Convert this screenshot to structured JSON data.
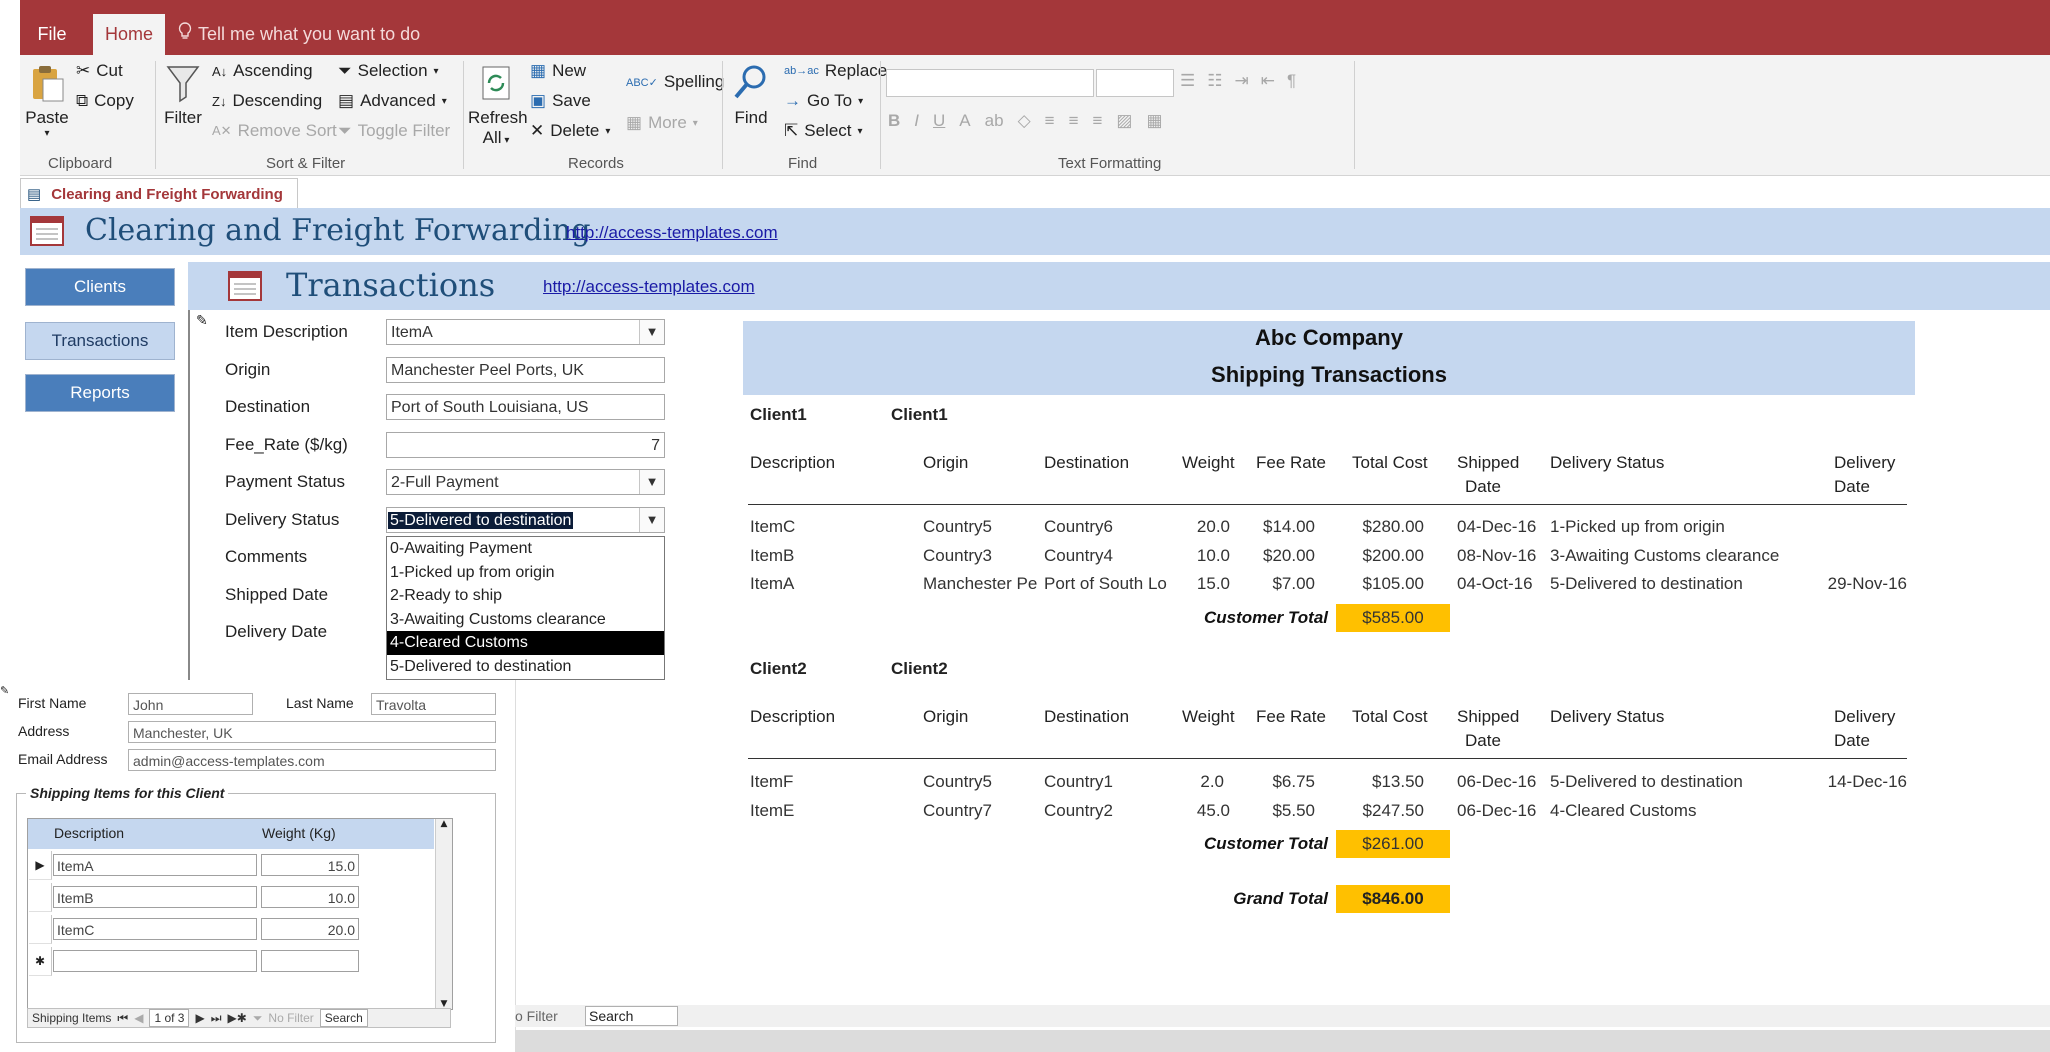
{
  "ribbon": {
    "tabs": {
      "file": "File",
      "home": "Home",
      "tell_me": "Tell me what you want to do"
    },
    "clipboard": {
      "paste": "Paste",
      "cut": "Cut",
      "copy": "Copy",
      "group": "Clipboard"
    },
    "sort_filter": {
      "filter": "Filter",
      "ascending": "Ascending",
      "descending": "Descending",
      "remove_sort": "Remove Sort",
      "selection": "Selection",
      "advanced": "Advanced",
      "toggle_filter": "Toggle Filter",
      "group": "Sort & Filter"
    },
    "records": {
      "refresh": "Refresh",
      "refresh_all": "All",
      "new": "New",
      "save": "Save",
      "delete": "Delete",
      "spelling": "Spelling",
      "more": "More",
      "group": "Records"
    },
    "find": {
      "find": "Find",
      "replace": "Replace",
      "goto": "Go To",
      "select": "Select",
      "group": "Find"
    },
    "text_formatting": {
      "group": "Text Formatting"
    }
  },
  "object_tab": "Clearing and Freight Forwarding",
  "main_header": {
    "title": "Clearing and Freight Forwarding",
    "link": "http://access-templates.com"
  },
  "nav": {
    "clients": "Clients",
    "transactions": "Transactions",
    "reports": "Reports"
  },
  "transactions_header": {
    "title": "Transactions",
    "link": "http://access-templates.com"
  },
  "form": {
    "labels": {
      "item_description": "Item Description",
      "origin": "Origin",
      "destination": "Destination",
      "fee_rate": "Fee_Rate ($/kg)",
      "payment_status": "Payment Status",
      "delivery_status": "Delivery Status",
      "comments": "Comments",
      "shipped_date": "Shipped Date",
      "delivery_date": "Delivery Date"
    },
    "values": {
      "item_description": "ItemA",
      "origin": "Manchester Peel Ports, UK",
      "destination": "Port of South Louisiana, US",
      "fee_rate": "7",
      "payment_status": "2-Full Payment",
      "delivery_status": "5-Delivered to destination"
    },
    "delivery_options": [
      "0-Awaiting Payment",
      "1-Picked up from origin",
      "2-Ready to ship",
      "3-Awaiting Customs clearance",
      "4-Cleared Customs",
      "5-Delivered to destination"
    ],
    "highlighted_option": "4-Cleared Customs"
  },
  "client": {
    "first_name_label": "First Name",
    "first_name": "John",
    "last_name_label": "Last Name",
    "last_name": "Travolta",
    "address_label": "Address",
    "address": "Manchester, UK",
    "email_label": "Email Address",
    "email": "admin@access-templates.com",
    "items_title": "Shipping Items for this Client",
    "grid_headers": {
      "description": "Description",
      "weight": "Weight (Kg)"
    },
    "grid_rows": [
      {
        "description": "ItemA",
        "weight": "15.0"
      },
      {
        "description": "ItemB",
        "weight": "10.0"
      },
      {
        "description": "ItemC",
        "weight": "20.0"
      }
    ],
    "navbar": {
      "label": "Shipping Items",
      "record": "1 of 3",
      "no_filter": "No Filter",
      "search": "Search"
    }
  },
  "outer_navbar": {
    "no_filter": "o Filter",
    "search": "Search"
  },
  "report": {
    "company": "Abc Company",
    "title": "Shipping Transactions",
    "columns": {
      "description": "Description",
      "origin": "Origin",
      "destination": "Destination",
      "weight": "Weight",
      "fee_rate": "Fee Rate",
      "total_cost": "Total Cost",
      "shipped": "Shipped",
      "shipped2": "Date",
      "delivery_status": "Delivery Status",
      "delivery": "Delivery",
      "delivery2": "Date"
    },
    "groups": [
      {
        "id_label": "Client1",
        "name": "Client1",
        "rows": [
          {
            "description": "ItemC",
            "origin": "Country5",
            "destination": "Country6",
            "weight": "20.0",
            "fee": "$14.00",
            "cost": "$280.00",
            "shipped": "04-Dec-16",
            "status": "1-Picked up from origin",
            "delivered": ""
          },
          {
            "description": "ItemB",
            "origin": "Country3",
            "destination": "Country4",
            "weight": "10.0",
            "fee": "$20.00",
            "cost": "$200.00",
            "shipped": "08-Nov-16",
            "status": "3-Awaiting Customs clearance",
            "delivered": ""
          },
          {
            "description": "ItemA",
            "origin": "Manchester Pe",
            "destination": "Port of South Lo",
            "weight": "15.0",
            "fee": "$7.00",
            "cost": "$105.00",
            "shipped": "04-Oct-16",
            "status": "5-Delivered to destination",
            "delivered": "29-Nov-16"
          }
        ],
        "total_label": "Customer Total",
        "total": "$585.00"
      },
      {
        "id_label": "Client2",
        "name": "Client2",
        "rows": [
          {
            "description": "ItemF",
            "origin": "Country5",
            "destination": "Country1",
            "weight": "2.0",
            "fee": "$6.75",
            "cost": "$13.50",
            "shipped": "06-Dec-16",
            "status": "5-Delivered to destination",
            "delivered": "14-Dec-16"
          },
          {
            "description": "ItemE",
            "origin": "Country7",
            "destination": "Country2",
            "weight": "45.0",
            "fee": "$5.50",
            "cost": "$247.50",
            "shipped": "06-Dec-16",
            "status": "4-Cleared Customs",
            "delivered": ""
          }
        ],
        "total_label": "Customer Total",
        "total": "$261.00"
      }
    ],
    "grand_total_label": "Grand Total",
    "grand_total": "$846.00"
  },
  "colors": {
    "ribbon_red": "#a4373a",
    "header_blue": "#c5d7ef",
    "nav_blue": "#4a7ebb",
    "total_gold": "#ffc000"
  }
}
